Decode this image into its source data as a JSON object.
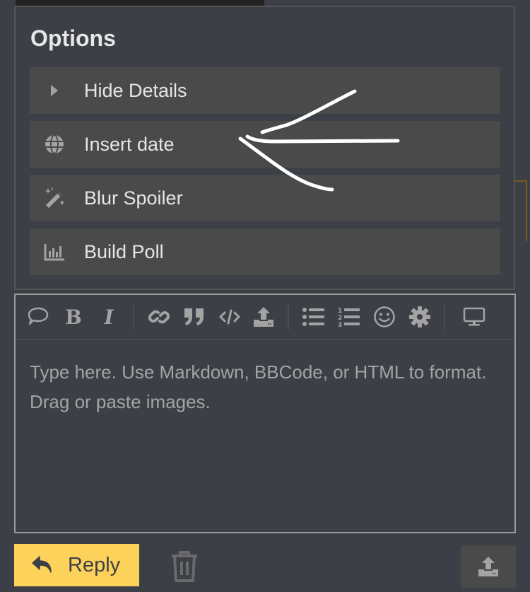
{
  "options": {
    "title": "Options",
    "items": [
      {
        "label": "Hide Details",
        "icon": "caret-right-icon"
      },
      {
        "label": "Insert date",
        "icon": "globe-icon"
      },
      {
        "label": "Blur Spoiler",
        "icon": "magic-wand-icon"
      },
      {
        "label": "Build Poll",
        "icon": "bar-chart-icon"
      }
    ]
  },
  "toolbar": {
    "buttons": [
      {
        "name": "quote-reply",
        "icon": "speech-bubble-icon"
      },
      {
        "name": "bold",
        "icon": "bold-icon",
        "glyph": "B"
      },
      {
        "name": "italic",
        "icon": "italic-icon",
        "glyph": "I"
      },
      {
        "name": "link",
        "icon": "link-icon"
      },
      {
        "name": "blockquote",
        "icon": "quote-icon"
      },
      {
        "name": "code",
        "icon": "code-icon"
      },
      {
        "name": "upload",
        "icon": "upload-icon"
      },
      {
        "name": "bullet-list",
        "icon": "bullet-list-icon"
      },
      {
        "name": "numbered-list",
        "icon": "numbered-list-icon"
      },
      {
        "name": "emoji",
        "icon": "smiley-icon"
      },
      {
        "name": "options",
        "icon": "gear-icon"
      },
      {
        "name": "preview",
        "icon": "monitor-icon"
      }
    ]
  },
  "editor": {
    "placeholder": "Type here. Use Markdown, BBCode, or HTML to format. Drag or paste images.",
    "value": ""
  },
  "actions": {
    "reply_label": "Reply"
  },
  "colors": {
    "accent": "#fdd25b",
    "background": "#3d3f47",
    "row": "#4a4a4a",
    "icon": "#a3a3a3",
    "annotation": "#ffffff"
  }
}
